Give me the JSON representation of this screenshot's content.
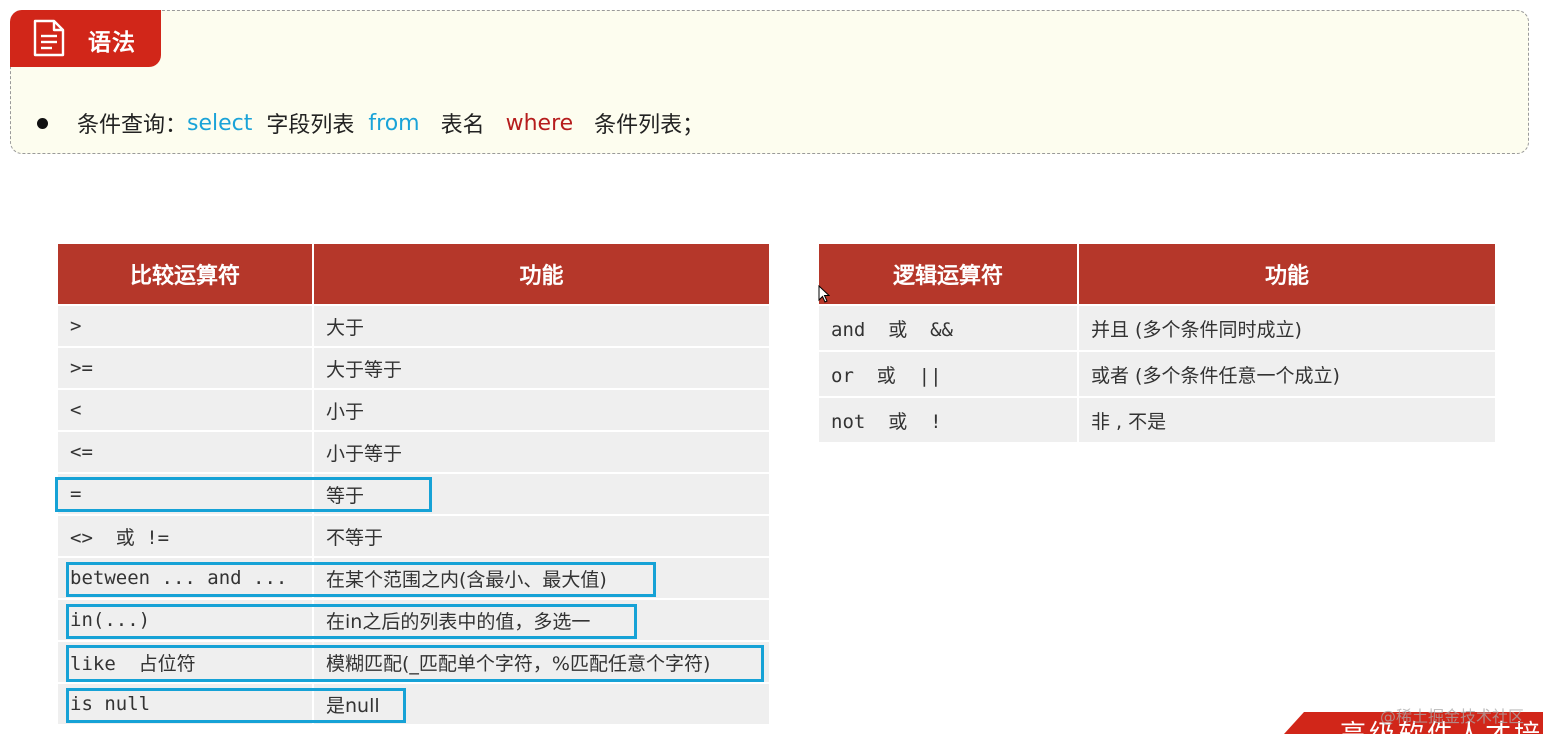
{
  "syntax": {
    "tab_label": "语法",
    "label": "条件查询：",
    "kw_select": "select",
    "fields": "字段列表",
    "kw_from": "from",
    "table": "表名",
    "kw_where": "where",
    "conditions": "条件列表；"
  },
  "comparison": {
    "headers": [
      "比较运算符",
      "功能"
    ],
    "rows": [
      {
        "op": ">",
        "fn": "大于"
      },
      {
        "op": ">=",
        "fn": "大于等于"
      },
      {
        "op": "<",
        "fn": "小于"
      },
      {
        "op": "<=",
        "fn": "小于等于"
      },
      {
        "op": "=",
        "fn": "等于"
      },
      {
        "op": "<>  或 !=",
        "fn": "不等于"
      },
      {
        "op": "between ... and ...",
        "fn": "在某个范围之内(含最小、最大值)"
      },
      {
        "op": "in(...)",
        "fn": "在in之后的列表中的值，多选一"
      },
      {
        "op": "like  占位符",
        "fn": "模糊匹配(_匹配单个字符，%匹配任意个字符)"
      },
      {
        "op": "is null",
        "fn": "是null"
      }
    ]
  },
  "logical": {
    "headers": [
      "逻辑运算符",
      "功能"
    ],
    "rows": [
      {
        "op": "and  或  &&",
        "fn": "并且 (多个条件同时成立)"
      },
      {
        "op": "or  或  ||",
        "fn": "或者 (多个条件任意一个成立)"
      },
      {
        "op": "not  或  !",
        "fn": "非 , 不是"
      }
    ]
  },
  "banner": {
    "text": "高级软件人才培",
    "watermark": "@稀土掘金技术社区"
  },
  "colors": {
    "accent_red": "#d12619",
    "header_red": "#b5372a",
    "highlight_blue": "#16a2d6",
    "keyword_blue": "#1aa3d8",
    "keyword_red": "#b61d1d"
  }
}
